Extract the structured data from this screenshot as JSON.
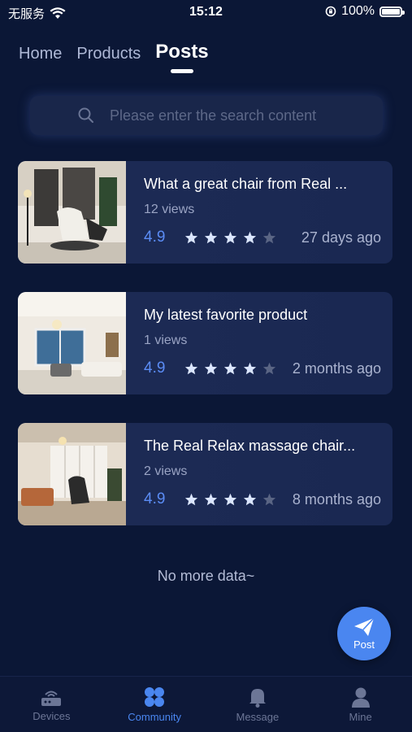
{
  "status_bar": {
    "carrier": "无服务",
    "time": "15:12",
    "battery": "100%"
  },
  "tabs": [
    {
      "label": "Home"
    },
    {
      "label": "Products"
    },
    {
      "label": "Posts"
    }
  ],
  "search": {
    "placeholder": "Please enter the search content"
  },
  "posts": [
    {
      "title": "What a great chair from Real ...",
      "views": "12 views",
      "rating": "4.9",
      "stars": 4,
      "date": "27 days ago"
    },
    {
      "title": "My latest favorite product",
      "views": "1 views",
      "rating": "4.9",
      "stars": 4,
      "date": "2 months ago"
    },
    {
      "title": "The Real Relax massage chair...",
      "views": "2 views",
      "rating": "4.9",
      "stars": 4,
      "date": "8 months ago"
    }
  ],
  "footer_text": "No more data~",
  "fab": {
    "label": "Post",
    "icon": "send-icon"
  },
  "bottom_nav": [
    {
      "label": "Devices",
      "icon": "router-icon"
    },
    {
      "label": "Community",
      "icon": "clover-icon"
    },
    {
      "label": "Message",
      "icon": "bell-icon"
    },
    {
      "label": "Mine",
      "icon": "user-icon"
    }
  ],
  "colors": {
    "background": "#0b1736",
    "accent": "#4a86f0",
    "star_filled": "#dbe6ff",
    "star_empty": "#5a6584"
  }
}
